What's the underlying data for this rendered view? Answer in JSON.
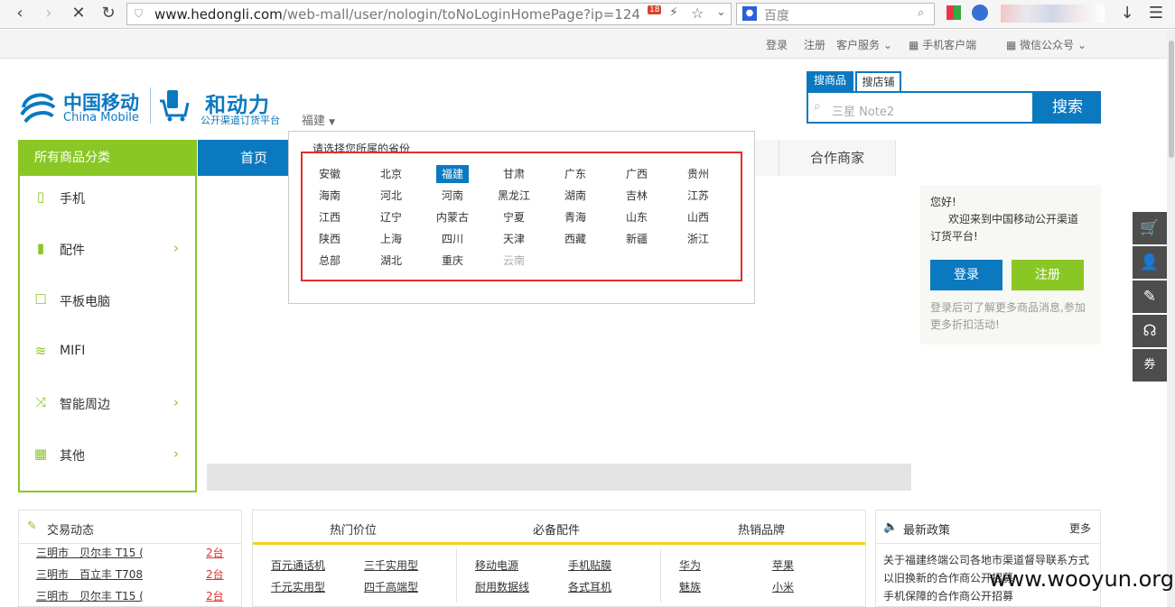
{
  "browser": {
    "url_host": "www.hedongli.com",
    "url_path": "/web-mall/user/nologin/toNoLoginHomePage?ip=124",
    "search_placeholder": "百度",
    "mail_badge": "18"
  },
  "topbar": {
    "login": "登录",
    "register": "注册",
    "service": "客户服务",
    "mobile_client": "手机客户端",
    "wechat": "微信公众号"
  },
  "header": {
    "logo_cn": "中国移动",
    "logo_en": "China Mobile",
    "brand_cn": "和动力",
    "brand_sub": "公开渠道订货平台",
    "province_selected": "福建"
  },
  "search": {
    "tab_goods": "搜商品",
    "tab_shops": "搜店铺",
    "placeholder": "三星 Note2",
    "button": "搜索"
  },
  "nav": {
    "all_categories": "所有商品分类",
    "home": "首页",
    "partner": "合作商家"
  },
  "categories": [
    {
      "label": "手机",
      "icon": "phone-icon",
      "arrow": false
    },
    {
      "label": "配件",
      "icon": "battery-icon",
      "arrow": true
    },
    {
      "label": "平板电脑",
      "icon": "tablet-icon",
      "arrow": false
    },
    {
      "label": "MIFI",
      "icon": "wifi-icon",
      "arrow": false
    },
    {
      "label": "智能周边",
      "icon": "shuffle-icon",
      "arrow": true
    },
    {
      "label": "其他",
      "icon": "grid-icon",
      "arrow": true
    }
  ],
  "province_popup": {
    "hint": "请选择您所属的省份",
    "rows": [
      [
        "安徽",
        "北京",
        "福建",
        "甘肃",
        "广东",
        "广西",
        "贵州"
      ],
      [
        "海南",
        "河北",
        "河南",
        "黑龙江",
        "湖南",
        "吉林",
        "江苏"
      ],
      [
        "江西",
        "辽宁",
        "内蒙古",
        "宁夏",
        "青海",
        "山东",
        "山西"
      ],
      [
        "陕西",
        "上海",
        "四川",
        "天津",
        "西藏",
        "新疆",
        "浙江"
      ],
      [
        "总部",
        "湖北",
        "重庆",
        "云南"
      ]
    ],
    "selected": "福建",
    "dimmed": "云南"
  },
  "login_box": {
    "greeting": "您好!",
    "welcome_1": "欢迎来到中国移动公开渠道",
    "welcome_2": "订货平台!",
    "login_button": "登录",
    "register_button": "注册",
    "tip_1": "登录后可了解更多商品消息,参加",
    "tip_2": "更多折扣活动!"
  },
  "right_toolbar": [
    {
      "icon": "cart-icon",
      "glyph": "🛒"
    },
    {
      "icon": "user-icon",
      "glyph": "👤"
    },
    {
      "icon": "edit-icon",
      "glyph": "✎"
    },
    {
      "icon": "headset-icon",
      "glyph": "☊"
    },
    {
      "icon": "coupon-icon",
      "glyph": "券"
    }
  ],
  "deals": {
    "title": "交易动态",
    "rows": [
      {
        "text": "三明市　贝尔丰 T15 (",
        "qty": "2台"
      },
      {
        "text": "三明市　百立丰 T708",
        "qty": "2台"
      },
      {
        "text": "三明市　贝尔丰 T15 (",
        "qty": "2台"
      }
    ]
  },
  "hot": {
    "tabs": [
      "热门价位",
      "必备配件",
      "热销品牌"
    ],
    "price_links": [
      [
        "百元通话机",
        "三千实用型"
      ],
      [
        "千元实用型",
        "四千高端型"
      ]
    ],
    "accessory_links": [
      [
        "移动电源",
        "手机贴膜"
      ],
      [
        "耐用数据线",
        "各式耳机"
      ]
    ],
    "brand_links": [
      [
        "华为",
        "苹果"
      ],
      [
        "魅族",
        "小米"
      ]
    ]
  },
  "policy": {
    "title": "最新政策",
    "more": "更多",
    "items": [
      "关于福建终端公司各地市渠道督导联系方式",
      "以旧换新的合作商公开招募",
      "手机保障的合作商公开招募"
    ]
  },
  "watermark": "www.wooyun.org"
}
